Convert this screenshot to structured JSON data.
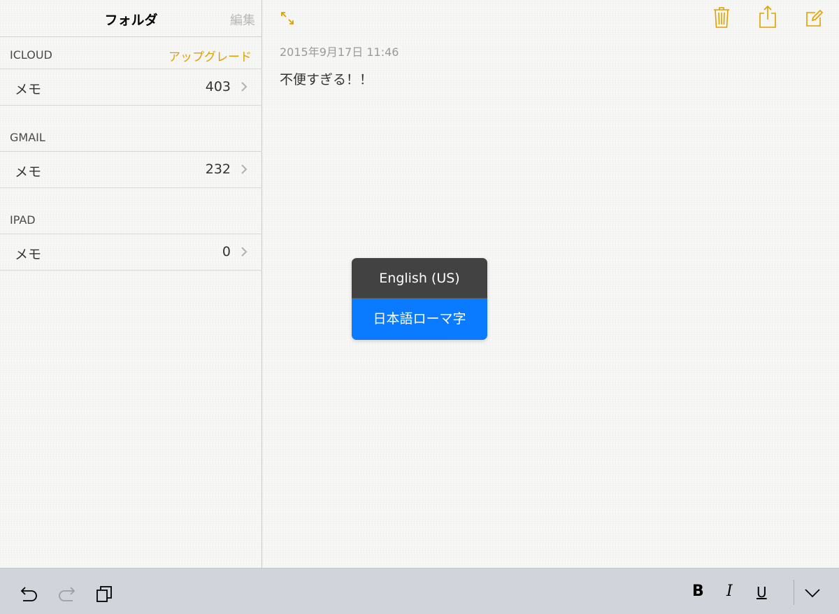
{
  "colors": {
    "accent": "#e0a000",
    "popup_dark": "#424242",
    "popup_blue": "#0a7aff",
    "toolbar_bg": "#d1d5db"
  },
  "sidebar": {
    "title": "フォルダ",
    "edit_label": "編集",
    "sections": [
      {
        "label": "ICLOUD",
        "action": "アップグレード",
        "row": {
          "label": "メモ",
          "count": "403"
        }
      },
      {
        "label": "GMAIL",
        "row": {
          "label": "メモ",
          "count": "232"
        }
      },
      {
        "label": "IPAD",
        "row": {
          "label": "メモ",
          "count": "0"
        }
      }
    ]
  },
  "main": {
    "timestamp": "2015年9月17日 11:46",
    "note_text": "不便すぎる！！",
    "icons": [
      "expand-icon",
      "trash-icon",
      "share-icon",
      "compose-icon"
    ]
  },
  "keyboard_popup": {
    "options": [
      "English (US)",
      "日本語ローマ字"
    ],
    "selected": "日本語ローマ字"
  },
  "toolbar": {
    "bold_label": "B",
    "italic_label": "I",
    "underline_label": "U",
    "icons": [
      "undo-icon",
      "redo-icon",
      "paste-icon",
      "dismiss-keyboard-icon"
    ]
  }
}
